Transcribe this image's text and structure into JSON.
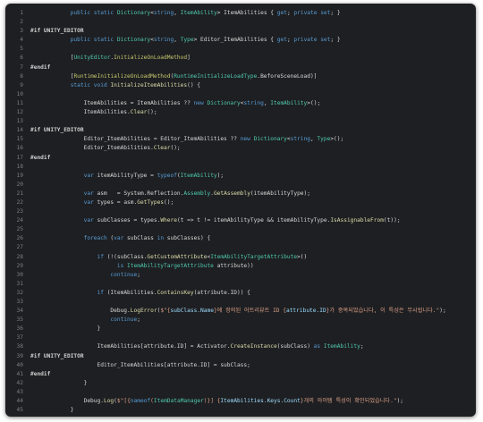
{
  "editor": {
    "lines": [
      {
        "n": "1",
        "t": [
          [
            "            ",
            ""
          ],
          [
            "public",
            "kw"
          ],
          [
            " ",
            ""
          ],
          [
            "static",
            "kw"
          ],
          [
            " ",
            ""
          ],
          [
            "Dictionary",
            "ty"
          ],
          [
            "<",
            ""
          ],
          [
            "string",
            "kw"
          ],
          [
            ", ",
            ""
          ],
          [
            "ItemAbility",
            "ty"
          ],
          [
            "> ItemAbilities { ",
            ""
          ],
          [
            "get",
            "kw"
          ],
          [
            "; ",
            ""
          ],
          [
            "private",
            "kw"
          ],
          [
            " ",
            ""
          ],
          [
            "set",
            "kw"
          ],
          [
            "; }",
            ""
          ]
        ]
      },
      {
        "n": "2",
        "t": []
      },
      {
        "n": "3",
        "t": [
          [
            "#if UNITY_EDITOR",
            "pp"
          ]
        ]
      },
      {
        "n": "4",
        "t": [
          [
            "            ",
            ""
          ],
          [
            "public",
            "kw"
          ],
          [
            " ",
            ""
          ],
          [
            "static",
            "kw"
          ],
          [
            " ",
            ""
          ],
          [
            "Dictionary",
            "ty"
          ],
          [
            "<",
            ""
          ],
          [
            "string",
            "kw"
          ],
          [
            ", ",
            ""
          ],
          [
            "Type",
            "ty"
          ],
          [
            "> Editor_ItemAbilities { ",
            ""
          ],
          [
            "get",
            "kw"
          ],
          [
            "; ",
            ""
          ],
          [
            "private",
            "kw"
          ],
          [
            " ",
            ""
          ],
          [
            "set",
            "kw"
          ],
          [
            "; }",
            ""
          ]
        ]
      },
      {
        "n": "5",
        "t": []
      },
      {
        "n": "6",
        "t": [
          [
            "            [",
            ""
          ],
          [
            "UnityEditor",
            "ty"
          ],
          [
            ".",
            ""
          ],
          [
            "InitializeOnLoadMethod",
            "at"
          ],
          [
            "]",
            ""
          ]
        ]
      },
      {
        "n": "7",
        "t": [
          [
            "#endif",
            "pp"
          ]
        ]
      },
      {
        "n": "8",
        "t": [
          [
            "            [",
            ""
          ],
          [
            "RuntimeInitializeOnLoadMethod",
            "at"
          ],
          [
            "(",
            ""
          ],
          [
            "RuntimeInitializeLoadType",
            "ty"
          ],
          [
            ".BeforeSceneLoad)]",
            ""
          ]
        ]
      },
      {
        "n": "9",
        "t": [
          [
            "            ",
            ""
          ],
          [
            "static",
            "kw"
          ],
          [
            " ",
            ""
          ],
          [
            "void",
            "kw"
          ],
          [
            " ",
            ""
          ],
          [
            "InitializeItemAbilities",
            "fn"
          ],
          [
            "() {",
            ""
          ]
        ]
      },
      {
        "n": "10",
        "t": []
      },
      {
        "n": "11",
        "t": [
          [
            "                ItemAbilities = ItemAbilities ?? ",
            ""
          ],
          [
            "new",
            "kw"
          ],
          [
            " ",
            ""
          ],
          [
            "Dictionary",
            "ty"
          ],
          [
            "<",
            ""
          ],
          [
            "string",
            "kw"
          ],
          [
            ", ",
            ""
          ],
          [
            "ItemAbility",
            "ty"
          ],
          [
            ">();",
            ""
          ]
        ]
      },
      {
        "n": "12",
        "t": [
          [
            "                ItemAbilities.",
            ""
          ],
          [
            "Clear",
            "fn"
          ],
          [
            "();",
            ""
          ]
        ]
      },
      {
        "n": "13",
        "t": []
      },
      {
        "n": "14",
        "t": [
          [
            "#if UNITY_EDITOR",
            "pp"
          ]
        ]
      },
      {
        "n": "15",
        "t": [
          [
            "                Editor_ItemAbilities = Editor_ItemAbilities ?? ",
            ""
          ],
          [
            "new",
            "kw"
          ],
          [
            " ",
            ""
          ],
          [
            "Dictionary",
            "ty"
          ],
          [
            "<",
            ""
          ],
          [
            "string",
            "kw"
          ],
          [
            ", ",
            ""
          ],
          [
            "Type",
            "ty"
          ],
          [
            ">();",
            ""
          ]
        ]
      },
      {
        "n": "16",
        "t": [
          [
            "                Editor_ItemAbilities.",
            ""
          ],
          [
            "Clear",
            "fn"
          ],
          [
            "();",
            ""
          ]
        ]
      },
      {
        "n": "17",
        "t": [
          [
            "#endif",
            "pp"
          ]
        ]
      },
      {
        "n": "18",
        "t": []
      },
      {
        "n": "19",
        "t": [
          [
            "                ",
            ""
          ],
          [
            "var",
            "kw"
          ],
          [
            " itemAbilityType = ",
            ""
          ],
          [
            "typeof",
            "kw"
          ],
          [
            "(",
            ""
          ],
          [
            "ItemAbility",
            "ty"
          ],
          [
            ");",
            ""
          ]
        ]
      },
      {
        "n": "20",
        "t": []
      },
      {
        "n": "21",
        "t": [
          [
            "                ",
            ""
          ],
          [
            "var",
            "kw"
          ],
          [
            " asm   = System.Reflection.",
            ""
          ],
          [
            "Assembly",
            "ty"
          ],
          [
            ".",
            ""
          ],
          [
            "GetAssembly",
            "fn"
          ],
          [
            "(itemAbilityType);",
            ""
          ]
        ]
      },
      {
        "n": "22",
        "t": [
          [
            "                ",
            ""
          ],
          [
            "var",
            "kw"
          ],
          [
            " types = asm.",
            ""
          ],
          [
            "GetTypes",
            "fn"
          ],
          [
            "();",
            ""
          ]
        ]
      },
      {
        "n": "23",
        "t": []
      },
      {
        "n": "24",
        "t": [
          [
            "                ",
            ""
          ],
          [
            "var",
            "kw"
          ],
          [
            " subClasses = types.",
            ""
          ],
          [
            "Where",
            "fn"
          ],
          [
            "(t => t != itemAbilityType && itemAbilityType.",
            ""
          ],
          [
            "IsAssignableFrom",
            "fn"
          ],
          [
            "(t));",
            ""
          ]
        ]
      },
      {
        "n": "25",
        "t": []
      },
      {
        "n": "26",
        "t": [
          [
            "                ",
            ""
          ],
          [
            "foreach",
            "kw"
          ],
          [
            " (",
            ""
          ],
          [
            "var",
            "kw"
          ],
          [
            " subClass ",
            ""
          ],
          [
            "in",
            "kw"
          ],
          [
            " subClasses) {",
            ""
          ]
        ]
      },
      {
        "n": "27",
        "t": []
      },
      {
        "n": "28",
        "t": [
          [
            "                    ",
            ""
          ],
          [
            "if",
            "kw"
          ],
          [
            " (!(subClass.",
            ""
          ],
          [
            "GetCustomAttribute",
            "fn"
          ],
          [
            "<",
            ""
          ],
          [
            "ItemAbilityTargetAttribute",
            "ty"
          ],
          [
            ">()",
            ""
          ]
        ]
      },
      {
        "n": "29",
        "t": [
          [
            "                          ",
            ""
          ],
          [
            "is",
            "kw"
          ],
          [
            " ",
            ""
          ],
          [
            "ItemAbilityTargetAttribute",
            "ty"
          ],
          [
            " attribute))",
            ""
          ]
        ]
      },
      {
        "n": "30",
        "t": [
          [
            "                        ",
            ""
          ],
          [
            "continue",
            "kw"
          ],
          [
            ";",
            ""
          ]
        ]
      },
      {
        "n": "31",
        "t": []
      },
      {
        "n": "32",
        "t": [
          [
            "                    ",
            ""
          ],
          [
            "if",
            "kw"
          ],
          [
            " (ItemAbilities.",
            ""
          ],
          [
            "ContainsKey",
            "fn"
          ],
          [
            "(attribute.ID)) {",
            ""
          ]
        ]
      },
      {
        "n": "33",
        "t": []
      },
      {
        "n": "34",
        "t": [
          [
            "                        Debug.",
            ""
          ],
          [
            "LogError",
            "fn"
          ],
          [
            "(",
            ""
          ],
          [
            "$\"{",
            "st"
          ],
          [
            "subClass.Name",
            "pa"
          ],
          [
            "}에 정의된 어트리뷰트 ID {",
            "st"
          ],
          [
            "attribute.ID",
            "pa"
          ],
          [
            "}가 중복되었습니다, 이 특성은 무시됩니다.\"",
            "st"
          ],
          [
            ");",
            ""
          ]
        ]
      },
      {
        "n": "35",
        "t": [
          [
            "                        ",
            ""
          ],
          [
            "continue",
            "kw"
          ],
          [
            ";",
            ""
          ]
        ]
      },
      {
        "n": "36",
        "t": [
          [
            "                    }",
            ""
          ]
        ]
      },
      {
        "n": "37",
        "t": []
      },
      {
        "n": "38",
        "t": [
          [
            "                    ItemAbilities[attribute.ID] = Activator.",
            ""
          ],
          [
            "CreateInstance",
            "fn"
          ],
          [
            "(subClass) ",
            ""
          ],
          [
            "as",
            "kw"
          ],
          [
            " ",
            ""
          ],
          [
            "ItemAbility",
            "ty"
          ],
          [
            ";",
            ""
          ]
        ]
      },
      {
        "n": "39",
        "t": [
          [
            "#if UNITY_EDITOR",
            "pp"
          ]
        ]
      },
      {
        "n": "40",
        "t": [
          [
            "                    Editor_ItemAbilities[attribute.ID] = subClass;",
            ""
          ]
        ]
      },
      {
        "n": "41",
        "t": [
          [
            "#endif",
            "pp"
          ]
        ]
      },
      {
        "n": "42",
        "t": [
          [
            "                }",
            ""
          ]
        ]
      },
      {
        "n": "43",
        "t": []
      },
      {
        "n": "44",
        "t": [
          [
            "                Debug.",
            ""
          ],
          [
            "Log",
            "fn"
          ],
          [
            "(",
            ""
          ],
          [
            "$\"[{",
            "st"
          ],
          [
            "nameof",
            "kw"
          ],
          [
            "(",
            "st"
          ],
          [
            "ItemDataManager",
            "ty"
          ],
          [
            ")}] {",
            "st"
          ],
          [
            "ItemAbilities.Keys.Count",
            "pa"
          ],
          [
            "}개의 아이템 특성이 확인되었습니다.\"",
            "st"
          ],
          [
            ");",
            ""
          ]
        ]
      },
      {
        "n": "45",
        "t": [
          [
            "            }",
            ""
          ]
        ]
      }
    ]
  }
}
